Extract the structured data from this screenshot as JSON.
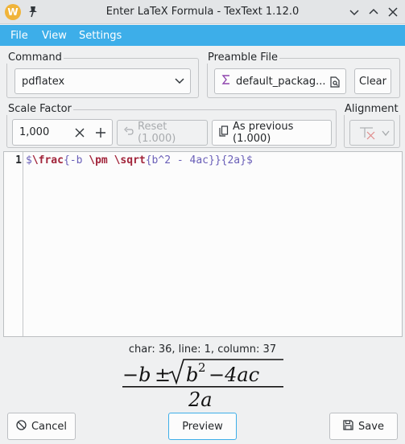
{
  "window": {
    "app_logo_letter": "W",
    "title": "Enter LaTeX Formula - TexText 1.12.0"
  },
  "menu": {
    "file": "File",
    "view": "View",
    "settings": "Settings"
  },
  "command": {
    "group_label": "Command",
    "selected": "pdflatex"
  },
  "preamble": {
    "group_label": "Preamble File",
    "file_name": "default_packag...",
    "clear_label": "Clear"
  },
  "scale": {
    "group_label": "Scale Factor",
    "value": "1,000",
    "reset_label": "Reset (1.000)",
    "as_previous_label": "As previous (1.000)"
  },
  "alignment": {
    "group_label": "Alignment"
  },
  "editor": {
    "line_number": "1",
    "tokens": {
      "t1": "$",
      "t2": "\\frac",
      "t3": "{-b ",
      "t4": "\\pm",
      "t5": " ",
      "t6": "\\sqrt",
      "t7": "{b^2 - 4ac}}{2a}$"
    }
  },
  "status_text": "char: 36, line: 1, column: 37",
  "formula_render": {
    "minus_b": "−b",
    "pm": "±",
    "b": "b",
    "exponent": "2",
    "minus_4ac": "−4ac",
    "denominator": "2a"
  },
  "buttons": {
    "cancel": "Cancel",
    "preview": "Preview",
    "save": "Save"
  },
  "colors": {
    "menubar": "#3daee9",
    "latex_command": "#a2253b",
    "latex_argument": "#6a5fb8"
  }
}
